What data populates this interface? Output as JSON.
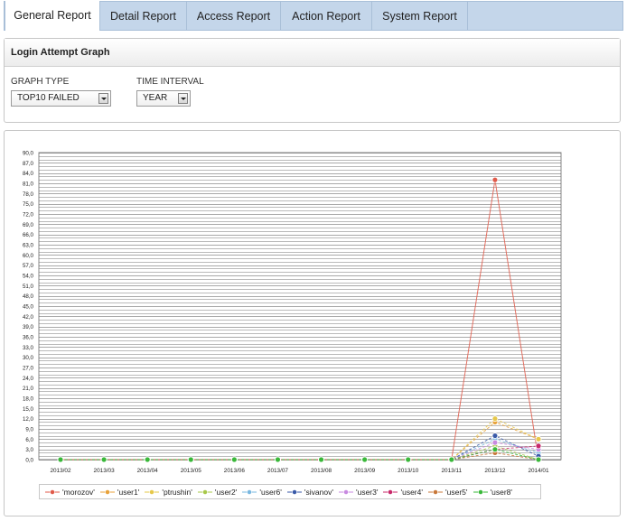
{
  "tabs": [
    "General Report",
    "Detail Report",
    "Access Report",
    "Action Report",
    "System Report"
  ],
  "panel": {
    "title": "Login Attempt Graph"
  },
  "filters": {
    "graph_type_label": "GRAPH TYPE",
    "graph_type_value": "TOP10 FAILED",
    "time_interval_label": "TIME INTERVAL",
    "time_interval_value": "YEAR"
  },
  "chart_data": {
    "type": "line",
    "title": "",
    "xlabel": "",
    "ylabel": "",
    "ylim": [
      0,
      90
    ],
    "y_ticks": [
      "0,0",
      "3,0",
      "6,0",
      "9,0",
      "12,0",
      "15,0",
      "18,0",
      "21,0",
      "24,0",
      "27,0",
      "30,0",
      "33,0",
      "36,0",
      "39,0",
      "42,0",
      "45,0",
      "48,0",
      "51,0",
      "54,0",
      "57,0",
      "60,0",
      "63,0",
      "66,0",
      "69,0",
      "72,0",
      "75,0",
      "78,0",
      "81,0",
      "84,0",
      "87,0",
      "90,0"
    ],
    "categories": [
      "2013/02",
      "2013/03",
      "2013/04",
      "2013/05",
      "2013/06",
      "2013/07",
      "2013/08",
      "2013/09",
      "2013/10",
      "2013/11",
      "2013/12",
      "2014/01"
    ],
    "grid": true,
    "legend_position": "bottom",
    "series": [
      {
        "name": "'morozov'",
        "color": "#e05a4a",
        "values": [
          0,
          0,
          0,
          0,
          0,
          0,
          0,
          0,
          0,
          0,
          82,
          0
        ]
      },
      {
        "name": "'user1'",
        "color": "#e8a23a",
        "values": [
          0,
          0,
          0,
          0,
          0,
          0,
          0,
          0,
          0,
          0,
          11,
          6
        ]
      },
      {
        "name": "'ptrushin'",
        "color": "#e6c84a",
        "values": [
          0,
          0,
          0,
          0,
          0,
          0,
          0,
          0,
          0,
          0,
          12,
          6
        ]
      },
      {
        "name": "'user2'",
        "color": "#a8c84a",
        "values": [
          0,
          0,
          0,
          0,
          0,
          0,
          0,
          0,
          0,
          0,
          4,
          0
        ]
      },
      {
        "name": "'user6'",
        "color": "#7ab8e0",
        "values": [
          0,
          0,
          0,
          0,
          0,
          0,
          0,
          0,
          0,
          0,
          6,
          2
        ]
      },
      {
        "name": "'sivanov'",
        "color": "#3a5aa8",
        "values": [
          0,
          0,
          0,
          0,
          0,
          0,
          0,
          0,
          0,
          0,
          7,
          1
        ]
      },
      {
        "name": "'user3'",
        "color": "#c88ae0",
        "values": [
          0,
          0,
          0,
          0,
          0,
          0,
          0,
          0,
          0,
          0,
          5,
          3
        ]
      },
      {
        "name": "'user4'",
        "color": "#c8286a",
        "values": [
          0,
          0,
          0,
          0,
          0,
          0,
          0,
          0,
          0,
          0,
          3,
          4
        ]
      },
      {
        "name": "'user5'",
        "color": "#c8783a",
        "values": [
          0,
          0,
          0,
          0,
          0,
          0,
          0,
          0,
          0,
          0,
          2,
          0
        ]
      },
      {
        "name": "'user8'",
        "color": "#3ab83a",
        "values": [
          0,
          0,
          0,
          0,
          0,
          0,
          0,
          0,
          0,
          0,
          3,
          0
        ]
      }
    ]
  }
}
